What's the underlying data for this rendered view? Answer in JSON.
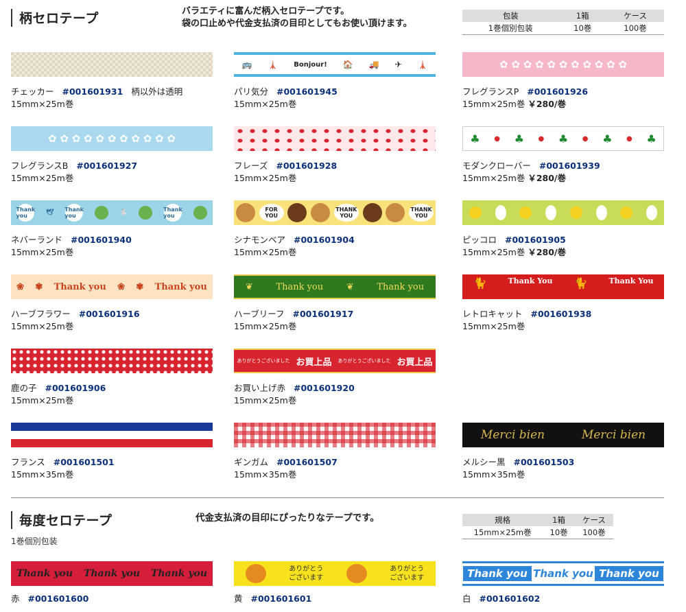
{
  "section1": {
    "title": "柄セロテープ",
    "desc_lines": [
      "バラエティに富んだ柄入セロテープです。",
      "袋の口止めや代金支払済の目印としてもお使い頂けます。"
    ],
    "spec": {
      "headers": [
        "包装",
        "1箱",
        "ケース"
      ],
      "row": [
        "1巻個別包装",
        "10巻",
        "100巻"
      ]
    },
    "items": [
      {
        "name": "チェッカー",
        "code": "#001601931",
        "extra": "柄以外は透明",
        "size": "15mm×25m巻",
        "price": ""
      },
      {
        "name": "パリ気分",
        "code": "#001601945",
        "extra": "",
        "size": "15mm×25m巻",
        "price": ""
      },
      {
        "name": "フレグランスP",
        "code": "#001601926",
        "extra": "",
        "size": "15mm×25m巻",
        "price": "￥280/巻"
      },
      {
        "name": "フレグランスB",
        "code": "#001601927",
        "extra": "",
        "size": "15mm×25m巻",
        "price": ""
      },
      {
        "name": "フレーズ",
        "code": "#001601928",
        "extra": "",
        "size": "15mm×25m巻",
        "price": ""
      },
      {
        "name": "モダンクローバー",
        "code": "#001601939",
        "extra": "",
        "size": "15mm×25m巻",
        "price": "￥280/巻"
      },
      {
        "name": "ネバーランド",
        "code": "#001601940",
        "extra": "",
        "size": "15mm×25m巻",
        "price": ""
      },
      {
        "name": "シナモンベア",
        "code": "#001601904",
        "extra": "",
        "size": "15mm×25m巻",
        "price": ""
      },
      {
        "name": "ピッコロ",
        "code": "#001601905",
        "extra": "",
        "size": "15mm×25m巻",
        "price": "￥280/巻"
      },
      {
        "name": "ハーブフラワー",
        "code": "#001601916",
        "extra": "",
        "size": "15mm×25m巻",
        "price": ""
      },
      {
        "name": "ハーブリーフ",
        "code": "#001601917",
        "extra": "",
        "size": "15mm×25m巻",
        "price": ""
      },
      {
        "name": "レトロキャット",
        "code": "#001601938",
        "extra": "",
        "size": "15mm×25m巻",
        "price": ""
      },
      {
        "name": "鹿の子",
        "code": "#001601906",
        "extra": "",
        "size": "15mm×25m巻",
        "price": ""
      },
      {
        "name": "お買い上げ赤",
        "code": "#001601920",
        "extra": "",
        "size": "15mm×25m巻",
        "price": ""
      },
      {
        "name": "フランス",
        "code": "#001601501",
        "extra": "",
        "size": "15mm×35m巻",
        "price": ""
      },
      {
        "name": "ギンガム",
        "code": "#001601507",
        "extra": "",
        "size": "15mm×35m巻",
        "price": ""
      },
      {
        "name": "メルシー黒",
        "code": "#001601503",
        "extra": "",
        "size": "15mm×35m巻",
        "price": ""
      }
    ]
  },
  "tape_text": {
    "bonjour": "Bonjour!",
    "thank_you": "Thank you",
    "thank_you_caps": "THANK YOU",
    "thank_you_retro": "Thank You",
    "for_you": "FOR YOU",
    "okaiage": "お買上品",
    "arigatou_gozaimashita": "ありがとうございました",
    "merci": "Merci bien",
    "arigatou": "ありがとう",
    "gozaimasu": "ございます"
  },
  "section2": {
    "title": "毎度セロテープ",
    "desc": "代金支払済の目印にぴったりなテープです。",
    "note": "1巻個別包装",
    "spec": {
      "headers": [
        "規格",
        "1箱",
        "ケース"
      ],
      "row": [
        "15mm×25m巻",
        "10巻",
        "100巻"
      ]
    },
    "items": [
      {
        "name": "赤",
        "code": "#001601600"
      },
      {
        "name": "黄",
        "code": "#001601601"
      },
      {
        "name": "白",
        "code": "#001601602"
      }
    ]
  }
}
